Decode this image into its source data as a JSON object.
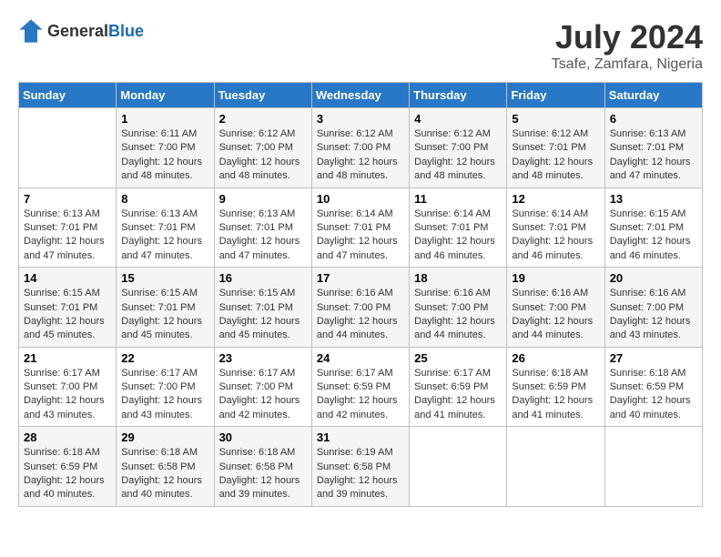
{
  "header": {
    "logo": {
      "general": "General",
      "blue": "Blue"
    },
    "title": "July 2024",
    "subtitle": "Tsafe, Zamfara, Nigeria"
  },
  "columns": [
    "Sunday",
    "Monday",
    "Tuesday",
    "Wednesday",
    "Thursday",
    "Friday",
    "Saturday"
  ],
  "weeks": [
    {
      "cells": [
        {
          "day": "",
          "sunrise": "",
          "sunset": "",
          "daylight": ""
        },
        {
          "day": "1",
          "sunrise": "Sunrise: 6:11 AM",
          "sunset": "Sunset: 7:00 PM",
          "daylight": "Daylight: 12 hours and 48 minutes."
        },
        {
          "day": "2",
          "sunrise": "Sunrise: 6:12 AM",
          "sunset": "Sunset: 7:00 PM",
          "daylight": "Daylight: 12 hours and 48 minutes."
        },
        {
          "day": "3",
          "sunrise": "Sunrise: 6:12 AM",
          "sunset": "Sunset: 7:00 PM",
          "daylight": "Daylight: 12 hours and 48 minutes."
        },
        {
          "day": "4",
          "sunrise": "Sunrise: 6:12 AM",
          "sunset": "Sunset: 7:00 PM",
          "daylight": "Daylight: 12 hours and 48 minutes."
        },
        {
          "day": "5",
          "sunrise": "Sunrise: 6:12 AM",
          "sunset": "Sunset: 7:01 PM",
          "daylight": "Daylight: 12 hours and 48 minutes."
        },
        {
          "day": "6",
          "sunrise": "Sunrise: 6:13 AM",
          "sunset": "Sunset: 7:01 PM",
          "daylight": "Daylight: 12 hours and 47 minutes."
        }
      ]
    },
    {
      "cells": [
        {
          "day": "7",
          "sunrise": "Sunrise: 6:13 AM",
          "sunset": "Sunset: 7:01 PM",
          "daylight": "Daylight: 12 hours and 47 minutes."
        },
        {
          "day": "8",
          "sunrise": "Sunrise: 6:13 AM",
          "sunset": "Sunset: 7:01 PM",
          "daylight": "Daylight: 12 hours and 47 minutes."
        },
        {
          "day": "9",
          "sunrise": "Sunrise: 6:13 AM",
          "sunset": "Sunset: 7:01 PM",
          "daylight": "Daylight: 12 hours and 47 minutes."
        },
        {
          "day": "10",
          "sunrise": "Sunrise: 6:14 AM",
          "sunset": "Sunset: 7:01 PM",
          "daylight": "Daylight: 12 hours and 47 minutes."
        },
        {
          "day": "11",
          "sunrise": "Sunrise: 6:14 AM",
          "sunset": "Sunset: 7:01 PM",
          "daylight": "Daylight: 12 hours and 46 minutes."
        },
        {
          "day": "12",
          "sunrise": "Sunrise: 6:14 AM",
          "sunset": "Sunset: 7:01 PM",
          "daylight": "Daylight: 12 hours and 46 minutes."
        },
        {
          "day": "13",
          "sunrise": "Sunrise: 6:15 AM",
          "sunset": "Sunset: 7:01 PM",
          "daylight": "Daylight: 12 hours and 46 minutes."
        }
      ]
    },
    {
      "cells": [
        {
          "day": "14",
          "sunrise": "Sunrise: 6:15 AM",
          "sunset": "Sunset: 7:01 PM",
          "daylight": "Daylight: 12 hours and 45 minutes."
        },
        {
          "day": "15",
          "sunrise": "Sunrise: 6:15 AM",
          "sunset": "Sunset: 7:01 PM",
          "daylight": "Daylight: 12 hours and 45 minutes."
        },
        {
          "day": "16",
          "sunrise": "Sunrise: 6:15 AM",
          "sunset": "Sunset: 7:01 PM",
          "daylight": "Daylight: 12 hours and 45 minutes."
        },
        {
          "day": "17",
          "sunrise": "Sunrise: 6:16 AM",
          "sunset": "Sunset: 7:00 PM",
          "daylight": "Daylight: 12 hours and 44 minutes."
        },
        {
          "day": "18",
          "sunrise": "Sunrise: 6:16 AM",
          "sunset": "Sunset: 7:00 PM",
          "daylight": "Daylight: 12 hours and 44 minutes."
        },
        {
          "day": "19",
          "sunrise": "Sunrise: 6:16 AM",
          "sunset": "Sunset: 7:00 PM",
          "daylight": "Daylight: 12 hours and 44 minutes."
        },
        {
          "day": "20",
          "sunrise": "Sunrise: 6:16 AM",
          "sunset": "Sunset: 7:00 PM",
          "daylight": "Daylight: 12 hours and 43 minutes."
        }
      ]
    },
    {
      "cells": [
        {
          "day": "21",
          "sunrise": "Sunrise: 6:17 AM",
          "sunset": "Sunset: 7:00 PM",
          "daylight": "Daylight: 12 hours and 43 minutes."
        },
        {
          "day": "22",
          "sunrise": "Sunrise: 6:17 AM",
          "sunset": "Sunset: 7:00 PM",
          "daylight": "Daylight: 12 hours and 43 minutes."
        },
        {
          "day": "23",
          "sunrise": "Sunrise: 6:17 AM",
          "sunset": "Sunset: 7:00 PM",
          "daylight": "Daylight: 12 hours and 42 minutes."
        },
        {
          "day": "24",
          "sunrise": "Sunrise: 6:17 AM",
          "sunset": "Sunset: 6:59 PM",
          "daylight": "Daylight: 12 hours and 42 minutes."
        },
        {
          "day": "25",
          "sunrise": "Sunrise: 6:17 AM",
          "sunset": "Sunset: 6:59 PM",
          "daylight": "Daylight: 12 hours and 41 minutes."
        },
        {
          "day": "26",
          "sunrise": "Sunrise: 6:18 AM",
          "sunset": "Sunset: 6:59 PM",
          "daylight": "Daylight: 12 hours and 41 minutes."
        },
        {
          "day": "27",
          "sunrise": "Sunrise: 6:18 AM",
          "sunset": "Sunset: 6:59 PM",
          "daylight": "Daylight: 12 hours and 40 minutes."
        }
      ]
    },
    {
      "cells": [
        {
          "day": "28",
          "sunrise": "Sunrise: 6:18 AM",
          "sunset": "Sunset: 6:59 PM",
          "daylight": "Daylight: 12 hours and 40 minutes."
        },
        {
          "day": "29",
          "sunrise": "Sunrise: 6:18 AM",
          "sunset": "Sunset: 6:58 PM",
          "daylight": "Daylight: 12 hours and 40 minutes."
        },
        {
          "day": "30",
          "sunrise": "Sunrise: 6:18 AM",
          "sunset": "Sunset: 6:58 PM",
          "daylight": "Daylight: 12 hours and 39 minutes."
        },
        {
          "day": "31",
          "sunrise": "Sunrise: 6:19 AM",
          "sunset": "Sunset: 6:58 PM",
          "daylight": "Daylight: 12 hours and 39 minutes."
        },
        {
          "day": "",
          "sunrise": "",
          "sunset": "",
          "daylight": ""
        },
        {
          "day": "",
          "sunrise": "",
          "sunset": "",
          "daylight": ""
        },
        {
          "day": "",
          "sunrise": "",
          "sunset": "",
          "daylight": ""
        }
      ]
    }
  ]
}
